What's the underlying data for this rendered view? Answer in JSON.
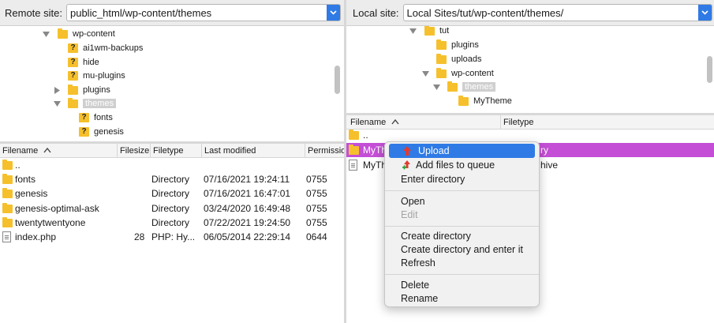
{
  "left": {
    "site_label": "Remote site:",
    "site_path": "public_html/wp-content/themes",
    "tree": [
      {
        "label": "wp-content",
        "icon": "folder",
        "expander": "expanded"
      },
      {
        "label": "ai1wm-backups",
        "icon": "unknown-folder"
      },
      {
        "label": "hide",
        "icon": "unknown-folder"
      },
      {
        "label": "mu-plugins",
        "icon": "unknown-folder"
      },
      {
        "label": "plugins",
        "icon": "folder",
        "expander": "collapsed"
      },
      {
        "label": "themes",
        "icon": "folder",
        "expander": "expanded",
        "selected": true
      },
      {
        "label": "fonts",
        "icon": "unknown-folder"
      },
      {
        "label": "genesis",
        "icon": "unknown-folder"
      }
    ],
    "columns": [
      "Filename",
      "Filesize",
      "Filetype",
      "Last modified",
      "Permissio"
    ],
    "files": [
      {
        "name": "..",
        "size": "",
        "type": "",
        "modified": "",
        "perm": "",
        "icon": "folder"
      },
      {
        "name": "fonts",
        "size": "",
        "type": "Directory",
        "modified": "07/16/2021 19:24:11",
        "perm": "0755",
        "icon": "folder"
      },
      {
        "name": "genesis",
        "size": "",
        "type": "Directory",
        "modified": "07/16/2021 16:47:01",
        "perm": "0755",
        "icon": "folder"
      },
      {
        "name": "genesis-optimal-ask",
        "size": "",
        "type": "Directory",
        "modified": "03/24/2020 16:49:48",
        "perm": "0755",
        "icon": "folder"
      },
      {
        "name": "twentytwentyone",
        "size": "",
        "type": "Directory",
        "modified": "07/22/2021 19:24:50",
        "perm": "0755",
        "icon": "folder"
      },
      {
        "name": "index.php",
        "size": "28",
        "type": "PHP: Hy...",
        "modified": "06/05/2014 22:29:14",
        "perm": "0644",
        "icon": "file"
      }
    ]
  },
  "right": {
    "site_label": "Local site:",
    "site_path": "Local Sites/tut/wp-content/themes/",
    "tree": [
      {
        "label": "tut",
        "icon": "folder",
        "expander": "expanded"
      },
      {
        "label": "plugins",
        "icon": "folder"
      },
      {
        "label": "uploads",
        "icon": "folder"
      },
      {
        "label": "wp-content",
        "icon": "folder",
        "expander": "expanded"
      },
      {
        "label": "themes",
        "icon": "folder",
        "expander": "expanded",
        "selected": true
      },
      {
        "label": "MyTheme",
        "icon": "folder"
      }
    ],
    "columns": [
      "Filename",
      "Filetype"
    ],
    "files": [
      {
        "name": "..",
        "type": "",
        "icon": "folder"
      },
      {
        "name": "MyTh",
        "type": "ry",
        "icon": "folder",
        "highlighted": true
      },
      {
        "name": "MyTh",
        "type": "hive",
        "icon": "file"
      }
    ]
  },
  "context_menu": {
    "items": [
      {
        "label": "Upload",
        "active": true,
        "icon": "upload-arrow-icon"
      },
      {
        "label": "Add files to queue",
        "icon": "add-to-queue-icon"
      },
      {
        "label": "Enter directory"
      },
      {
        "separator": true
      },
      {
        "label": "Open"
      },
      {
        "label": "Edit",
        "disabled": true
      },
      {
        "separator": true
      },
      {
        "label": "Create directory"
      },
      {
        "label": "Create directory and enter it"
      },
      {
        "label": "Refresh"
      },
      {
        "separator": true
      },
      {
        "label": "Delete"
      },
      {
        "label": "Rename"
      }
    ]
  },
  "colors": {
    "accent": "#2f7ae5",
    "folder": "#f6c02c",
    "row_highlight": "#c44fd6"
  }
}
